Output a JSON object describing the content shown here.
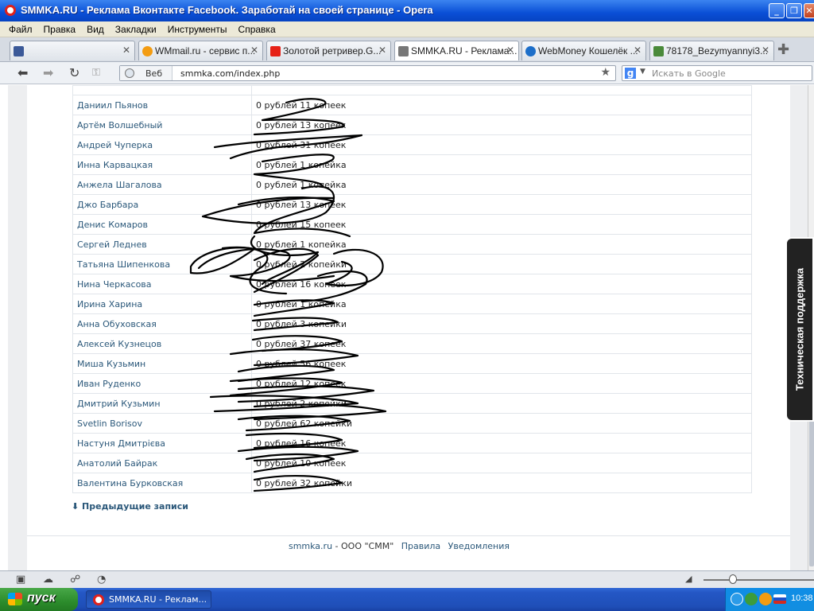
{
  "window": {
    "title": "SMMKA.RU - Реклама Вконтакте Facebook. Заработай на своей странице - Opera",
    "min": "_",
    "max": "❐",
    "close": "✕"
  },
  "menu": [
    "Файл",
    "Правка",
    "Вид",
    "Закладки",
    "Инструменты",
    "Справка"
  ],
  "tabs": [
    {
      "label": "",
      "active": false,
      "color": "#3b5998"
    },
    {
      "label": "WMmail.ru - сервис п...",
      "active": false,
      "color": "#f39c12"
    },
    {
      "label": "Золотой ретривер.G...",
      "active": false,
      "color": "#e62117"
    },
    {
      "label": "SMMKA.RU - Реклама...",
      "active": true,
      "color": "#777777"
    },
    {
      "label": "WebMoney Кошелёк ...",
      "active": false,
      "color": "#1c6ec9"
    },
    {
      "label": "78178_Bezymyannyi3...",
      "active": false,
      "color": "#4a8a3a"
    }
  ],
  "address": {
    "web_label": "Веб",
    "url": "smmka.com/index.php",
    "search_placeholder": "Искать в Google"
  },
  "winners": [
    {
      "name": "Даниил Пьянов",
      "amount": "0 рублей 11 копеек"
    },
    {
      "name": "Артём Волшебный",
      "amount": "0 рублей 13 копеек"
    },
    {
      "name": "Андрей Чуперка",
      "amount": "0 рублей 31 копеек"
    },
    {
      "name": "Инна Карвацкая",
      "amount": "0 рублей 1 копейка"
    },
    {
      "name": "Анжела Шагалова",
      "amount": "0 рублей 1 копейка"
    },
    {
      "name": "Джо Барбара",
      "amount": "0 рублей 13 копеек"
    },
    {
      "name": "Денис Комаров",
      "amount": "0 рублей 15 копеек"
    },
    {
      "name": "Сергей Леднев",
      "amount": "0 рублей 1 копейка"
    },
    {
      "name": "Татьяна Шипенкова",
      "amount": "0 рублей 2 копейки"
    },
    {
      "name": "Нина Черкасова",
      "amount": "0 рублей 16 копеек"
    },
    {
      "name": "Ирина Харина",
      "amount": "0 рублей 1 копейка"
    },
    {
      "name": "Анна Обуховская",
      "amount": "0 рублей 3 копейки"
    },
    {
      "name": "Алексей Кузнецов",
      "amount": "0 рублей 37 копеек"
    },
    {
      "name": "Миша Кузьмин",
      "amount": "0 рублей 56 копеек"
    },
    {
      "name": "Иван Руденко",
      "amount": "0 рублей 12 копеек"
    },
    {
      "name": "Дмитрий Кузьмин",
      "amount": "0 рублей 2 копейки"
    },
    {
      "name": "Svetlin Borisov",
      "amount": "0 рублей 62 копейки"
    },
    {
      "name": "Настуня Дмитрієва",
      "amount": "0 рублей 16 копеек"
    },
    {
      "name": "Анатолий Байрак",
      "amount": "0 рублей 10 копеек"
    },
    {
      "name": "Валентина Бурковская",
      "amount": "0 рублей 32 копейки"
    }
  ],
  "prev_link": "Предыдущие записи",
  "footer": {
    "site": "smmka.ru",
    "company": " - ООО \"СММ\"",
    "rules": "Правила",
    "notifications": "Уведомления"
  },
  "support_tab": "Техническая поддержка",
  "taskbar": {
    "start": "пуск",
    "window": "SMMKA.RU - Реклам...",
    "clock": "10:38"
  }
}
